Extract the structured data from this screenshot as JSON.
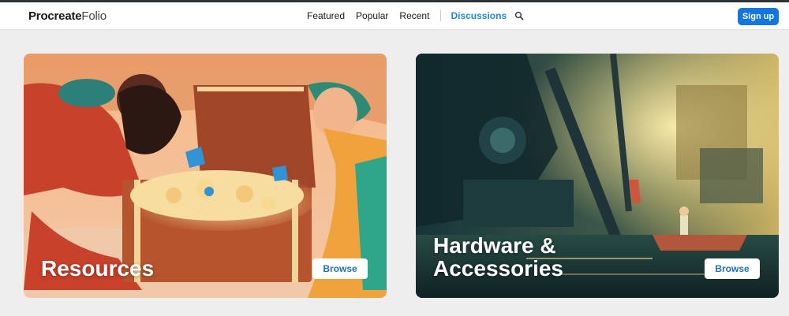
{
  "header": {
    "logo_brand": "Procreate",
    "logo_sub": "Folio",
    "nav": {
      "featured": "Featured",
      "popular": "Popular",
      "recent": "Recent",
      "discussions": "Discussions"
    },
    "signup_label": "Sign up"
  },
  "cards": [
    {
      "title": "Resources",
      "browse_label": "Browse"
    },
    {
      "title": "Hardware &\nAccessories",
      "browse_label": "Browse"
    }
  ],
  "colors": {
    "accent": "#1f8ae0",
    "signup_bg": "#1275e0",
    "background": "#eeeeee"
  }
}
